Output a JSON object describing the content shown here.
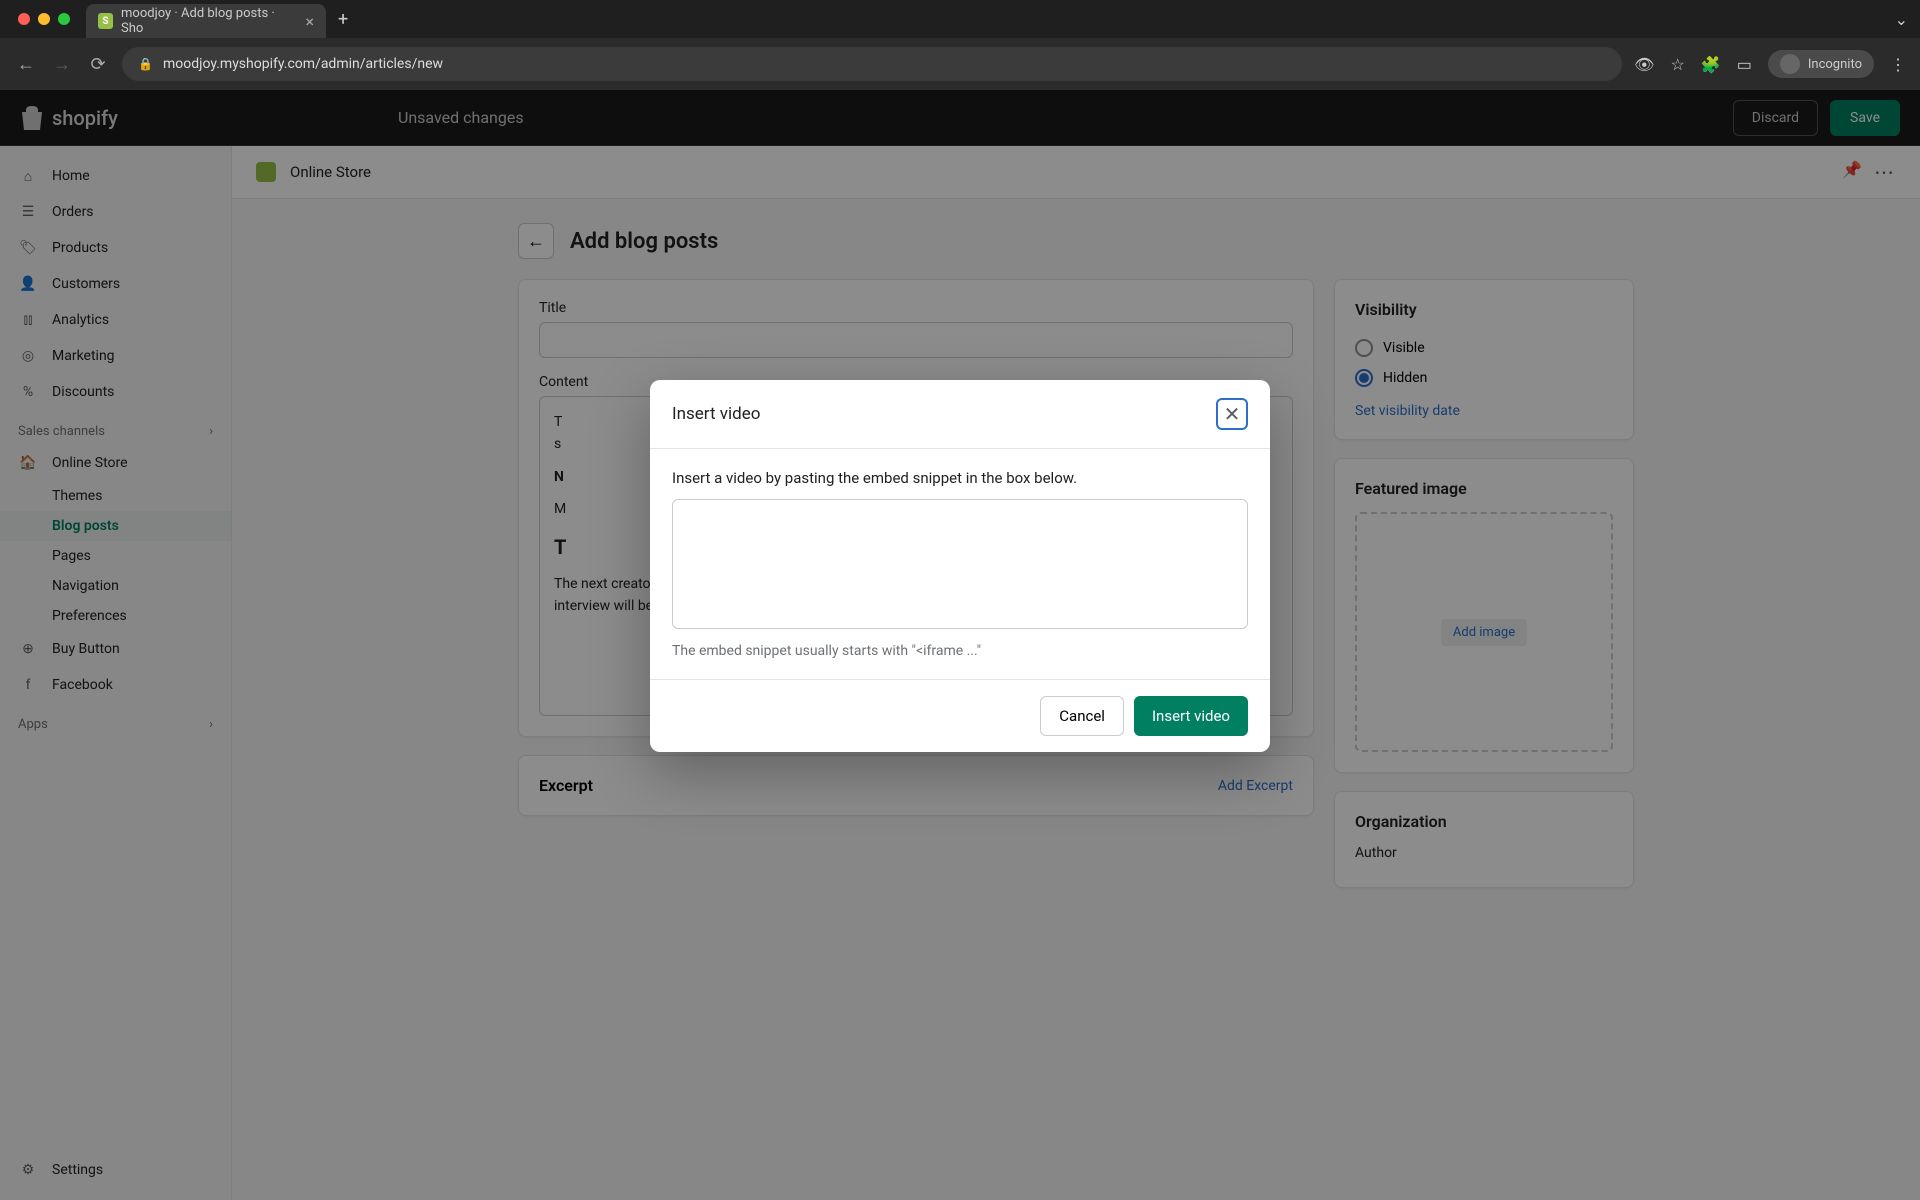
{
  "browser": {
    "tab_title": "moodjoy · Add blog posts · Sho",
    "url": "moodjoy.myshopify.com/admin/articles/new",
    "incognito_label": "Incognito"
  },
  "topbar": {
    "brand": "shopify",
    "unsaved_label": "Unsaved changes",
    "discard_label": "Discard",
    "save_label": "Save"
  },
  "sidebar": {
    "items": [
      {
        "label": "Home",
        "icon": "home"
      },
      {
        "label": "Orders",
        "icon": "orders"
      },
      {
        "label": "Products",
        "icon": "products"
      },
      {
        "label": "Customers",
        "icon": "customers"
      },
      {
        "label": "Analytics",
        "icon": "analytics"
      },
      {
        "label": "Marketing",
        "icon": "marketing"
      },
      {
        "label": "Discounts",
        "icon": "discounts"
      }
    ],
    "section_label": "Sales channels",
    "online_store_label": "Online Store",
    "sub_items": [
      {
        "label": "Themes"
      },
      {
        "label": "Blog posts"
      },
      {
        "label": "Pages"
      },
      {
        "label": "Navigation"
      },
      {
        "label": "Preferences"
      }
    ],
    "buy_button_label": "Buy Button",
    "facebook_label": "Facebook",
    "apps_label": "Apps",
    "settings_label": "Settings"
  },
  "breadcrumb": {
    "text": "Online Store"
  },
  "page": {
    "title": "Add blog posts",
    "title_field_label": "Title",
    "content_field_label": "Content",
    "body_paragraph": "The next creator interview will be next Monday.  The next creator interview will be next Monday. The next creator interview will be next Monday. The next creator interview will be next Monday.",
    "excerpt_label": "Excerpt",
    "add_excerpt_label": "Add Excerpt"
  },
  "visibility": {
    "title": "Visibility",
    "visible_label": "Visible",
    "hidden_label": "Hidden",
    "set_date_label": "Set visibility date"
  },
  "featured_image": {
    "title": "Featured image",
    "add_image_label": "Add image"
  },
  "organization": {
    "title": "Organization",
    "author_label": "Author"
  },
  "modal": {
    "title": "Insert video",
    "instruction": "Insert a video by pasting the embed snippet in the box below.",
    "hint": "The embed snippet usually starts with \"<iframe ...\"",
    "cancel_label": "Cancel",
    "submit_label": "Insert video"
  }
}
